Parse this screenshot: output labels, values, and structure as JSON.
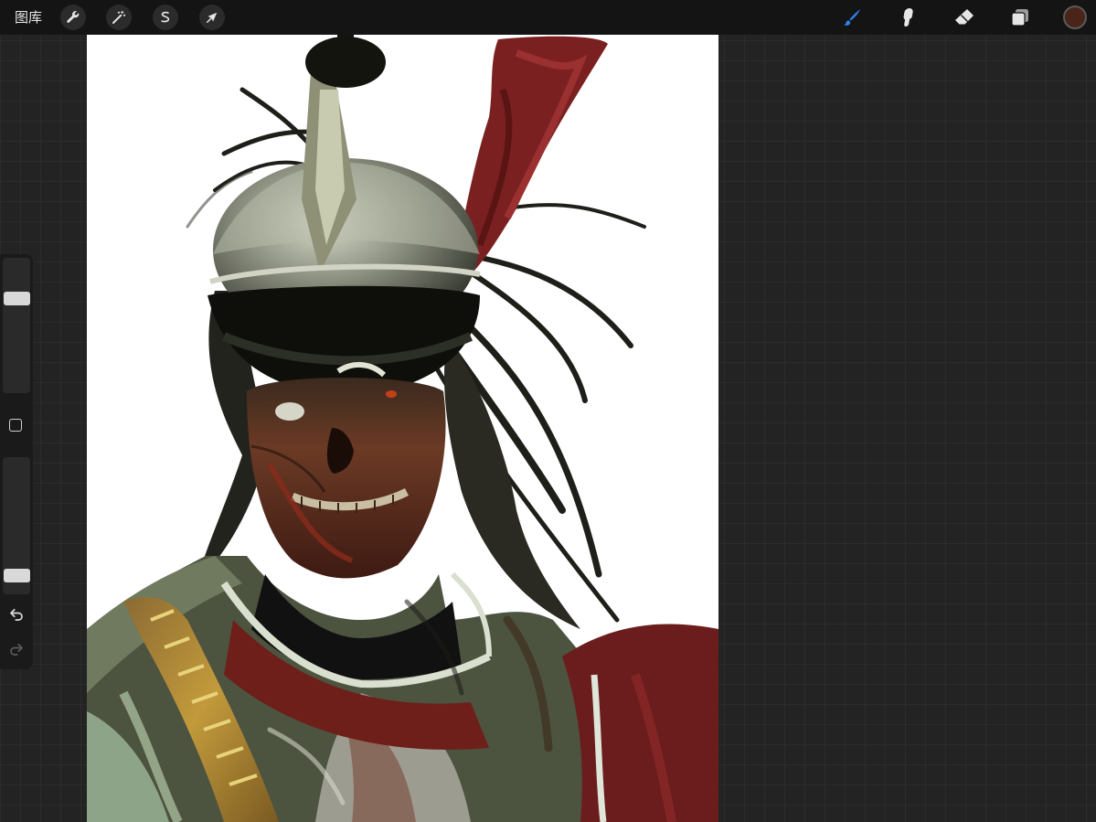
{
  "toolbar": {
    "gallery_label": "图库",
    "left_tools": [
      {
        "icon": "wrench-icon",
        "name": "actions"
      },
      {
        "icon": "magic-wand-icon",
        "name": "adjustments"
      },
      {
        "icon": "selection-icon",
        "name": "selection"
      },
      {
        "icon": "arrow-cursor-icon",
        "name": "transform"
      }
    ],
    "right_tools": [
      {
        "icon": "brush-icon",
        "name": "paint",
        "active": true
      },
      {
        "icon": "smudge-icon",
        "name": "smudge"
      },
      {
        "icon": "eraser-icon",
        "name": "eraser"
      },
      {
        "icon": "layers-icon",
        "name": "layers"
      }
    ],
    "active_color": "#4a2418",
    "accent_color": "#2f7ff0"
  },
  "sidebar": {
    "brush_size_level": 0.72,
    "opacity_level": 0.1,
    "icons": [
      "modify-square-icon",
      "undo-icon",
      "redo-icon"
    ]
  },
  "canvas": {
    "background": "#ffffff",
    "content": "painting"
  }
}
